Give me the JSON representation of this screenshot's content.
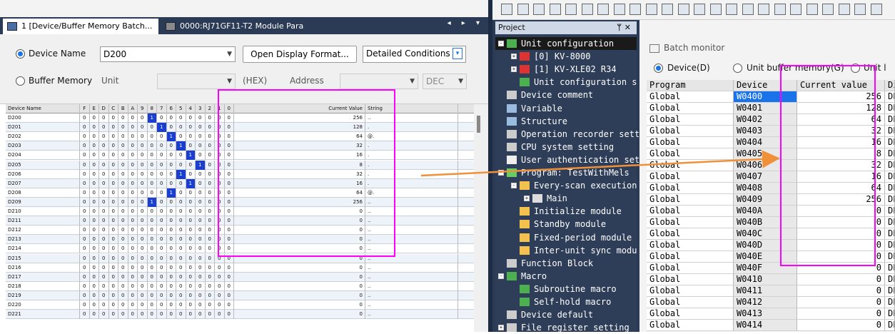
{
  "left": {
    "tabs": [
      {
        "label": "1 [Device/Buffer Memory Batch..."
      },
      {
        "label": "0000:RJ71GF11-T2 Module Para..."
      }
    ],
    "tab_nav": "◂ ▸ ▾",
    "device_name_label": "Device Name",
    "buffer_memory_label": "Buffer Memory",
    "device_value": "D200",
    "open_display_format": "Open Display Format...",
    "detailed_conditions": "Detailed Conditions",
    "unit_label": "Unit",
    "hex_label": "(HEX)",
    "address_label": "Address",
    "dec_value": "DEC",
    "grid_headers": {
      "device": "Device Name",
      "bits": [
        "F",
        "E",
        "D",
        "C",
        "B",
        "A",
        "9",
        "8",
        "7",
        "6",
        "5",
        "4",
        "3",
        "2",
        "1",
        "0"
      ],
      "current": "Current Value",
      "string": "String"
    },
    "rows": [
      {
        "dev": "D200",
        "on": [
          7
        ],
        "val": "256",
        "str": ".."
      },
      {
        "dev": "D201",
        "on": [
          8
        ],
        "val": "128",
        "str": "."
      },
      {
        "dev": "D202",
        "on": [
          9
        ],
        "val": "64",
        "str": "@."
      },
      {
        "dev": "D203",
        "on": [
          10
        ],
        "val": "32",
        "str": "."
      },
      {
        "dev": "D204",
        "on": [
          11
        ],
        "val": "16",
        "str": "."
      },
      {
        "dev": "D205",
        "on": [
          12
        ],
        "val": "8",
        "str": "."
      },
      {
        "dev": "D206",
        "on": [
          10
        ],
        "val": "32",
        "str": "."
      },
      {
        "dev": "D207",
        "on": [
          11
        ],
        "val": "16",
        "str": "."
      },
      {
        "dev": "D208",
        "on": [
          9
        ],
        "val": "64",
        "str": "@."
      },
      {
        "dev": "D209",
        "on": [
          7
        ],
        "val": "256",
        "str": ".."
      },
      {
        "dev": "D210",
        "on": [],
        "val": "0",
        "str": ".."
      },
      {
        "dev": "D211",
        "on": [],
        "val": "0",
        "str": ".."
      },
      {
        "dev": "D212",
        "on": [],
        "val": "0",
        "str": ".."
      },
      {
        "dev": "D213",
        "on": [],
        "val": "0",
        "str": ".."
      },
      {
        "dev": "D214",
        "on": [],
        "val": "0",
        "str": ".."
      },
      {
        "dev": "D215",
        "on": [],
        "val": "0",
        "str": ".."
      },
      {
        "dev": "D216",
        "on": [],
        "val": "0",
        "str": ".."
      },
      {
        "dev": "D217",
        "on": [],
        "val": "0",
        "str": ".."
      },
      {
        "dev": "D218",
        "on": [],
        "val": "0",
        "str": ".."
      },
      {
        "dev": "D219",
        "on": [],
        "val": "0",
        "str": ".."
      },
      {
        "dev": "D220",
        "on": [],
        "val": "0",
        "str": ".."
      },
      {
        "dev": "D221",
        "on": [],
        "val": "0",
        "str": ".."
      }
    ]
  },
  "project": {
    "title": "Project",
    "header_buttons": "ᛘ ✕",
    "tree": [
      {
        "label": "Unit configuration",
        "level": 0,
        "exp": "-",
        "icon": "unit-config-icon",
        "sel": true
      },
      {
        "label": "[0]  KV-8000",
        "level": 1,
        "exp": "+",
        "icon": "cpu-unit-icon"
      },
      {
        "label": "[1]  KV-XLE02     R34",
        "level": 1,
        "exp": "+",
        "icon": "cpu-unit-icon"
      },
      {
        "label": "Unit configuration s",
        "level": 1,
        "exp": "",
        "icon": "unit-config-icon"
      },
      {
        "label": "Device comment",
        "level": 0,
        "exp": "",
        "icon": "comment-icon"
      },
      {
        "label": "Variable",
        "level": 0,
        "exp": "",
        "icon": "variable-icon"
      },
      {
        "label": "Structure",
        "level": 0,
        "exp": "",
        "icon": "structure-icon"
      },
      {
        "label": "Operation recorder sett",
        "level": 0,
        "exp": "",
        "icon": "recorder-icon"
      },
      {
        "label": "CPU system setting",
        "level": 0,
        "exp": "",
        "icon": "cpu-setting-icon"
      },
      {
        "label": "User authentication set",
        "level": 0,
        "exp": "",
        "icon": "user-icon"
      },
      {
        "label": "Program: TestWithMels",
        "level": 0,
        "exp": "-",
        "icon": "program-icon"
      },
      {
        "label": "Every-scan execution",
        "level": 1,
        "exp": "-",
        "icon": "folder-icon"
      },
      {
        "label": "Main",
        "level": 2,
        "exp": "+",
        "icon": "ladder-icon"
      },
      {
        "label": "Initialize module",
        "level": 1,
        "exp": "",
        "icon": "folder-icon"
      },
      {
        "label": "Standby module",
        "level": 1,
        "exp": "",
        "icon": "folder-icon"
      },
      {
        "label": "Fixed-period module",
        "level": 1,
        "exp": "",
        "icon": "folder-icon"
      },
      {
        "label": "Inter-unit sync modu",
        "level": 1,
        "exp": "",
        "icon": "folder-icon"
      },
      {
        "label": "Function Block",
        "level": 0,
        "exp": "",
        "icon": "function-block-icon"
      },
      {
        "label": "Macro",
        "level": 0,
        "exp": "-",
        "icon": "macro-icon"
      },
      {
        "label": "Subroutine macro",
        "level": 1,
        "exp": "",
        "icon": "macro-icon"
      },
      {
        "label": "Self-hold macro",
        "level": 1,
        "exp": "",
        "icon": "macro-icon"
      },
      {
        "label": "Device default",
        "level": 0,
        "exp": "",
        "icon": "device-default-icon"
      },
      {
        "label": "File register setting",
        "level": 0,
        "exp": "+",
        "icon": "file-register-icon"
      }
    ]
  },
  "batch": {
    "title": "Batch monitor",
    "radio_device": "Device(D)",
    "radio_buffer": "Unit buffer memory(G)",
    "radio_unit": "Unit l",
    "headers": {
      "program": "Program",
      "device": "Device",
      "current": "Current value",
      "disp": "Di"
    },
    "rows": [
      {
        "p": "Global",
        "d": "W0400",
        "v": "256",
        "f": "DE"
      },
      {
        "p": "Global",
        "d": "W0401",
        "v": "128",
        "f": "DE"
      },
      {
        "p": "Global",
        "d": "W0402",
        "v": "64",
        "f": "DE"
      },
      {
        "p": "Global",
        "d": "W0403",
        "v": "32",
        "f": "DE"
      },
      {
        "p": "Global",
        "d": "W0404",
        "v": "16",
        "f": "DE"
      },
      {
        "p": "Global",
        "d": "W0405",
        "v": "8",
        "f": "DE"
      },
      {
        "p": "Global",
        "d": "W0406",
        "v": "32",
        "f": "DE"
      },
      {
        "p": "Global",
        "d": "W0407",
        "v": "16",
        "f": "DE"
      },
      {
        "p": "Global",
        "d": "W0408",
        "v": "64",
        "f": "DE"
      },
      {
        "p": "Global",
        "d": "W0409",
        "v": "256",
        "f": "DE"
      },
      {
        "p": "Global",
        "d": "W040A",
        "v": "0",
        "f": "DE"
      },
      {
        "p": "Global",
        "d": "W040B",
        "v": "0",
        "f": "DE"
      },
      {
        "p": "Global",
        "d": "W040C",
        "v": "0",
        "f": "DE"
      },
      {
        "p": "Global",
        "d": "W040D",
        "v": "0",
        "f": "DE"
      },
      {
        "p": "Global",
        "d": "W040E",
        "v": "0",
        "f": "DE"
      },
      {
        "p": "Global",
        "d": "W040F",
        "v": "0",
        "f": "DE"
      },
      {
        "p": "Global",
        "d": "W0410",
        "v": "0",
        "f": "DE"
      },
      {
        "p": "Global",
        "d": "W0411",
        "v": "0",
        "f": "DE"
      },
      {
        "p": "Global",
        "d": "W0412",
        "v": "0",
        "f": "DE"
      },
      {
        "p": "Global",
        "d": "W0413",
        "v": "0",
        "f": "DE"
      },
      {
        "p": "Global",
        "d": "W0414",
        "v": "0",
        "f": "DE"
      }
    ]
  },
  "colors": {
    "highlight_box": "#ff00ff",
    "arrow": "#f0913a",
    "bit_on": "#1a3fd0"
  }
}
